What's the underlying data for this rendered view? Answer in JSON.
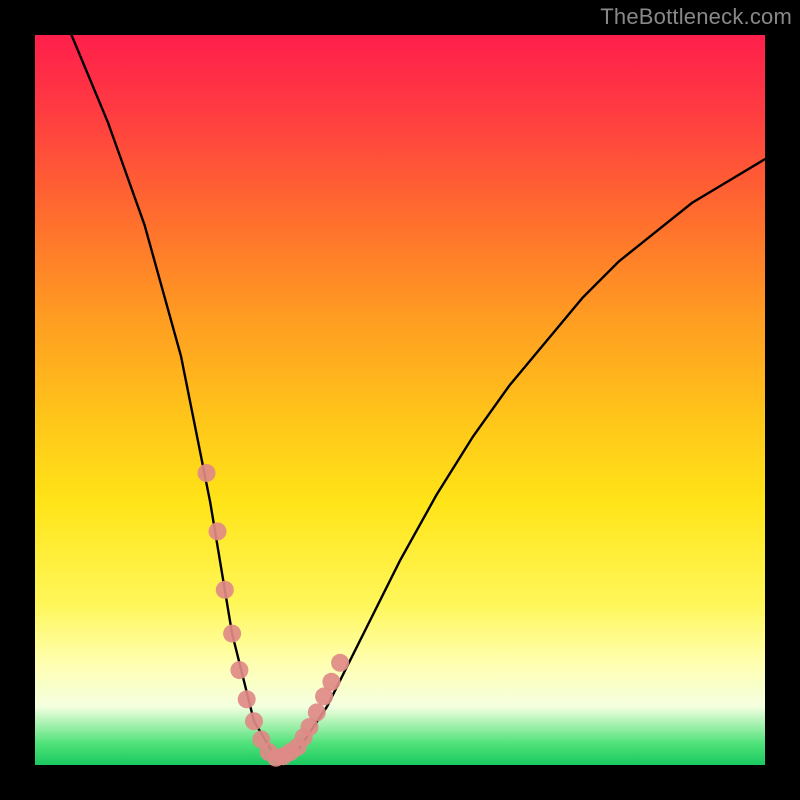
{
  "watermark": "TheBottleneck.com",
  "chart_data": {
    "type": "line",
    "title": "",
    "xlabel": "",
    "ylabel": "",
    "xlim": [
      0,
      100
    ],
    "ylim": [
      0,
      100
    ],
    "series": [
      {
        "name": "bottleneck-curve",
        "x": [
          5,
          10,
          15,
          20,
          24,
          27,
          30,
          33,
          36,
          40,
          45,
          50,
          55,
          60,
          65,
          70,
          75,
          80,
          85,
          90,
          95,
          100
        ],
        "values": [
          100,
          88,
          74,
          56,
          36,
          18,
          6,
          1,
          2,
          8,
          18,
          28,
          37,
          45,
          52,
          58,
          64,
          69,
          73,
          77,
          80,
          83
        ]
      }
    ],
    "markers": {
      "name": "highlighted-points",
      "color": "#e08a87",
      "x": [
        23.5,
        25.0,
        26.0,
        27.0,
        28.0,
        29.0,
        30.0,
        31.0,
        32.0,
        33.0,
        34.0,
        35.0,
        36.0,
        36.8,
        37.6,
        38.6,
        39.6,
        40.6,
        41.8
      ],
      "values": [
        40.0,
        32.0,
        24.0,
        18.0,
        13.0,
        9.0,
        6.0,
        3.5,
        1.8,
        1.0,
        1.2,
        1.8,
        2.5,
        3.8,
        5.2,
        7.2,
        9.4,
        11.4,
        14.0
      ]
    },
    "background_gradient": {
      "top": "#ff1f4b",
      "mid": "#ffe418",
      "bottom": "#18c95f"
    }
  }
}
